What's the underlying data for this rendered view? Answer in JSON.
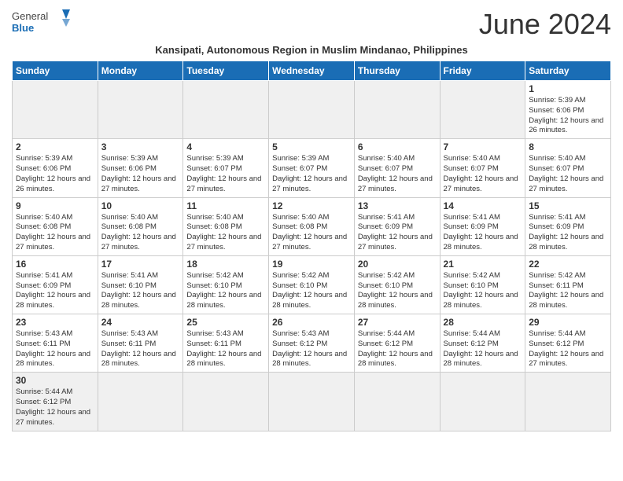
{
  "header": {
    "title": "June 2024",
    "subtitle": "Kansipati, Autonomous Region in Muslim Mindanao, Philippines",
    "logo_general": "General",
    "logo_blue": "Blue"
  },
  "days_of_week": [
    "Sunday",
    "Monday",
    "Tuesday",
    "Wednesday",
    "Thursday",
    "Friday",
    "Saturday"
  ],
  "weeks": [
    [
      {
        "day": "",
        "info": ""
      },
      {
        "day": "",
        "info": ""
      },
      {
        "day": "",
        "info": ""
      },
      {
        "day": "",
        "info": ""
      },
      {
        "day": "",
        "info": ""
      },
      {
        "day": "",
        "info": ""
      },
      {
        "day": "1",
        "info": "Sunrise: 5:39 AM\nSunset: 6:06 PM\nDaylight: 12 hours and 26 minutes."
      }
    ],
    [
      {
        "day": "2",
        "info": "Sunrise: 5:39 AM\nSunset: 6:06 PM\nDaylight: 12 hours and 26 minutes."
      },
      {
        "day": "3",
        "info": "Sunrise: 5:39 AM\nSunset: 6:06 PM\nDaylight: 12 hours and 27 minutes."
      },
      {
        "day": "4",
        "info": "Sunrise: 5:39 AM\nSunset: 6:07 PM\nDaylight: 12 hours and 27 minutes."
      },
      {
        "day": "5",
        "info": "Sunrise: 5:39 AM\nSunset: 6:07 PM\nDaylight: 12 hours and 27 minutes."
      },
      {
        "day": "6",
        "info": "Sunrise: 5:40 AM\nSunset: 6:07 PM\nDaylight: 12 hours and 27 minutes."
      },
      {
        "day": "7",
        "info": "Sunrise: 5:40 AM\nSunset: 6:07 PM\nDaylight: 12 hours and 27 minutes."
      },
      {
        "day": "8",
        "info": "Sunrise: 5:40 AM\nSunset: 6:07 PM\nDaylight: 12 hours and 27 minutes."
      }
    ],
    [
      {
        "day": "9",
        "info": "Sunrise: 5:40 AM\nSunset: 6:08 PM\nDaylight: 12 hours and 27 minutes."
      },
      {
        "day": "10",
        "info": "Sunrise: 5:40 AM\nSunset: 6:08 PM\nDaylight: 12 hours and 27 minutes."
      },
      {
        "day": "11",
        "info": "Sunrise: 5:40 AM\nSunset: 6:08 PM\nDaylight: 12 hours and 27 minutes."
      },
      {
        "day": "12",
        "info": "Sunrise: 5:40 AM\nSunset: 6:08 PM\nDaylight: 12 hours and 27 minutes."
      },
      {
        "day": "13",
        "info": "Sunrise: 5:41 AM\nSunset: 6:09 PM\nDaylight: 12 hours and 27 minutes."
      },
      {
        "day": "14",
        "info": "Sunrise: 5:41 AM\nSunset: 6:09 PM\nDaylight: 12 hours and 28 minutes."
      },
      {
        "day": "15",
        "info": "Sunrise: 5:41 AM\nSunset: 6:09 PM\nDaylight: 12 hours and 28 minutes."
      }
    ],
    [
      {
        "day": "16",
        "info": "Sunrise: 5:41 AM\nSunset: 6:09 PM\nDaylight: 12 hours and 28 minutes."
      },
      {
        "day": "17",
        "info": "Sunrise: 5:41 AM\nSunset: 6:10 PM\nDaylight: 12 hours and 28 minutes."
      },
      {
        "day": "18",
        "info": "Sunrise: 5:42 AM\nSunset: 6:10 PM\nDaylight: 12 hours and 28 minutes."
      },
      {
        "day": "19",
        "info": "Sunrise: 5:42 AM\nSunset: 6:10 PM\nDaylight: 12 hours and 28 minutes."
      },
      {
        "day": "20",
        "info": "Sunrise: 5:42 AM\nSunset: 6:10 PM\nDaylight: 12 hours and 28 minutes."
      },
      {
        "day": "21",
        "info": "Sunrise: 5:42 AM\nSunset: 6:10 PM\nDaylight: 12 hours and 28 minutes."
      },
      {
        "day": "22",
        "info": "Sunrise: 5:42 AM\nSunset: 6:11 PM\nDaylight: 12 hours and 28 minutes."
      }
    ],
    [
      {
        "day": "23",
        "info": "Sunrise: 5:43 AM\nSunset: 6:11 PM\nDaylight: 12 hours and 28 minutes."
      },
      {
        "day": "24",
        "info": "Sunrise: 5:43 AM\nSunset: 6:11 PM\nDaylight: 12 hours and 28 minutes."
      },
      {
        "day": "25",
        "info": "Sunrise: 5:43 AM\nSunset: 6:11 PM\nDaylight: 12 hours and 28 minutes."
      },
      {
        "day": "26",
        "info": "Sunrise: 5:43 AM\nSunset: 6:12 PM\nDaylight: 12 hours and 28 minutes."
      },
      {
        "day": "27",
        "info": "Sunrise: 5:44 AM\nSunset: 6:12 PM\nDaylight: 12 hours and 28 minutes."
      },
      {
        "day": "28",
        "info": "Sunrise: 5:44 AM\nSunset: 6:12 PM\nDaylight: 12 hours and 28 minutes."
      },
      {
        "day": "29",
        "info": "Sunrise: 5:44 AM\nSunset: 6:12 PM\nDaylight: 12 hours and 27 minutes."
      }
    ],
    [
      {
        "day": "30",
        "info": "Sunrise: 5:44 AM\nSunset: 6:12 PM\nDaylight: 12 hours and 27 minutes."
      },
      {
        "day": "",
        "info": ""
      },
      {
        "day": "",
        "info": ""
      },
      {
        "day": "",
        "info": ""
      },
      {
        "day": "",
        "info": ""
      },
      {
        "day": "",
        "info": ""
      },
      {
        "day": "",
        "info": ""
      }
    ]
  ]
}
